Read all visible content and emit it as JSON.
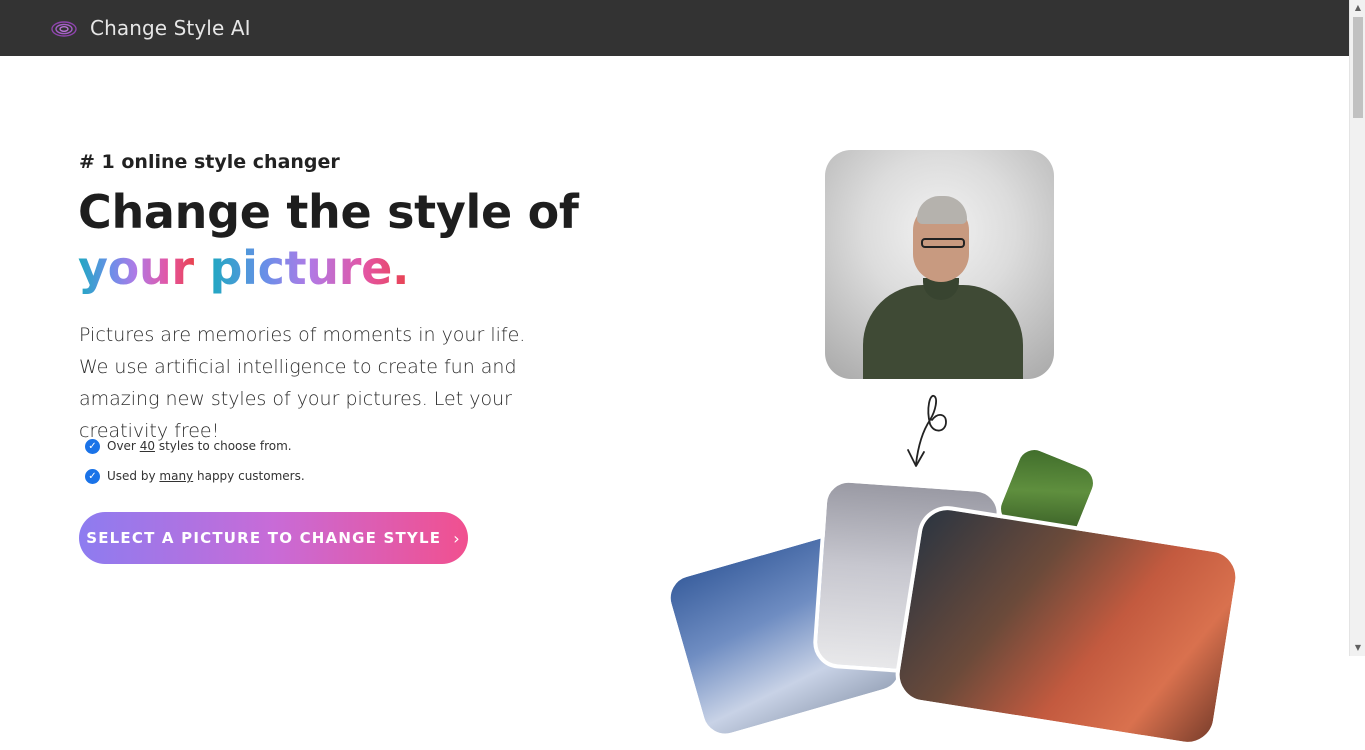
{
  "header": {
    "app_name": "Change Style AI",
    "logo_icon": "spiral-logo-icon"
  },
  "hero": {
    "eyebrow": "# 1 online style changer",
    "headline_line1": "Change the style of",
    "headline_word1": "your",
    "headline_word2": "picture.",
    "description": "Pictures are memories of moments in your life. We use artificial intelligence to create fun and amazing new styles of your pictures. Let your creativity free!",
    "features": [
      {
        "before": "Over ",
        "link": "40",
        "after": " styles to choose from."
      },
      {
        "before": "Used by ",
        "link": "many",
        "after": " happy customers."
      }
    ],
    "cta_label": "SELECT A PICTURE TO CHANGE STYLE",
    "cta_icon": "chevron-right-icon"
  },
  "colors": {
    "header_bg": "#333333",
    "check": "#1a73e8",
    "gradient_start": "#8d7cf0",
    "gradient_end": "#f1508f"
  }
}
